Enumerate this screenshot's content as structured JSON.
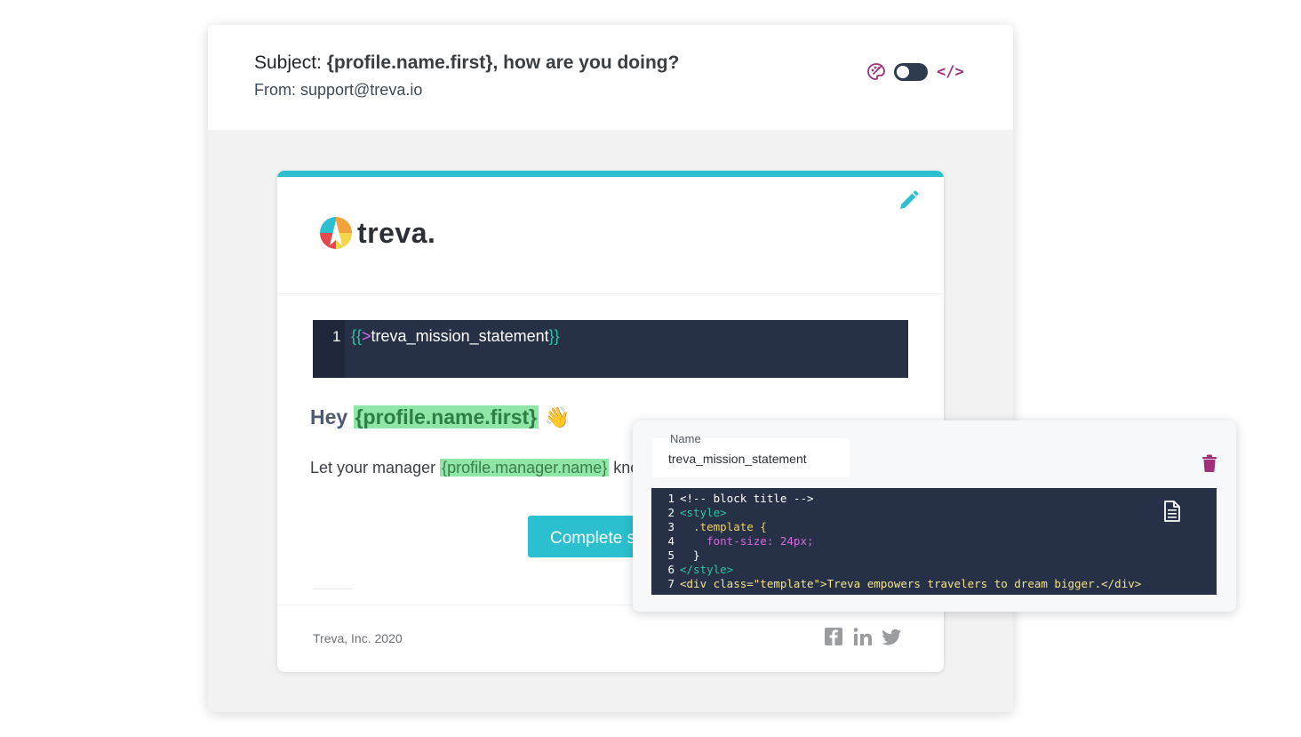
{
  "header": {
    "subject_label": "Subject:",
    "subject_text": "{profile.name.first}, how are you doing?",
    "from_text": "From: support@treva.io",
    "icons": [
      "palette-icon",
      "toggle-switch",
      "code-icon"
    ],
    "code_icon_text": "</>",
    "toggle_state": "off"
  },
  "email": {
    "logo_text": "treva.",
    "partial_line_number": "1",
    "partial_open_brace": "{{",
    "partial_gt": ">",
    "partial_name": "treva_mission_statement",
    "partial_close_brace": "}}",
    "greeting_prefix": "Hey",
    "greeting_tag": "{profile.name.first}",
    "greeting_emoji": "👋",
    "body_prefix": "Let your manager",
    "body_tag": "{profile.manager.name}",
    "body_suffix": "kno",
    "cta_label": "Complete s",
    "footer_text": "Treva, Inc. 2020",
    "social_icons": [
      "facebook-icon",
      "linkedin-icon",
      "twitter-icon"
    ],
    "accent_color": "#2cbfcf",
    "tag_highlight_color": "#8fe6a6"
  },
  "editor": {
    "name_label": "Name",
    "name_value": "treva_mission_statement",
    "code_lines": [
      {
        "n": "1",
        "text": "<!-- block title -->"
      },
      {
        "n": "2",
        "text": "<style>"
      },
      {
        "n": "3",
        "text": "  .template {"
      },
      {
        "n": "4",
        "text": "    font-size: 24px;"
      },
      {
        "n": "5",
        "text": "  }"
      },
      {
        "n": "6",
        "text": "</style>"
      },
      {
        "n": "7",
        "text": "<div class=\"template\">Treva empowers travelers to dream bigger.</div>"
      }
    ],
    "code_background": "#263147",
    "delete_color": "#a0307a"
  }
}
